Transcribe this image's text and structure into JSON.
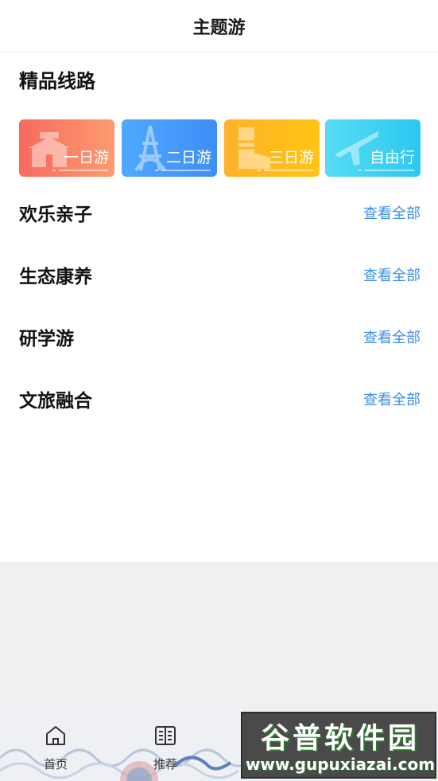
{
  "header": {
    "title": "主题游"
  },
  "featured": {
    "title": "精品线路",
    "cards": [
      {
        "label": "一日游",
        "icon": "gate-icon",
        "color": "#f96a5d"
      },
      {
        "label": "二日游",
        "icon": "tower-icon",
        "color": "#4fa9ff"
      },
      {
        "label": "三日游",
        "icon": "boot-icon",
        "color": "#ffb22a"
      },
      {
        "label": "自由行",
        "icon": "airplane-icon",
        "color": "#2cc8f1"
      }
    ]
  },
  "categories": [
    {
      "title": "欢乐亲子",
      "link": "查看全部"
    },
    {
      "title": "生态康养",
      "link": "查看全部"
    },
    {
      "title": "研学游",
      "link": "查看全部"
    },
    {
      "title": "文旅融合",
      "link": "查看全部"
    }
  ],
  "tabbar": {
    "items": [
      {
        "label": "首页",
        "icon": "home-icon"
      },
      {
        "label": "推荐",
        "icon": "book-icon"
      }
    ]
  },
  "watermark": {
    "line1": "谷普软件园",
    "line2": "www.gupuxiazai.com"
  },
  "colors": {
    "link": "#3d8ee5",
    "gray_bg": "#f0f0f3"
  }
}
